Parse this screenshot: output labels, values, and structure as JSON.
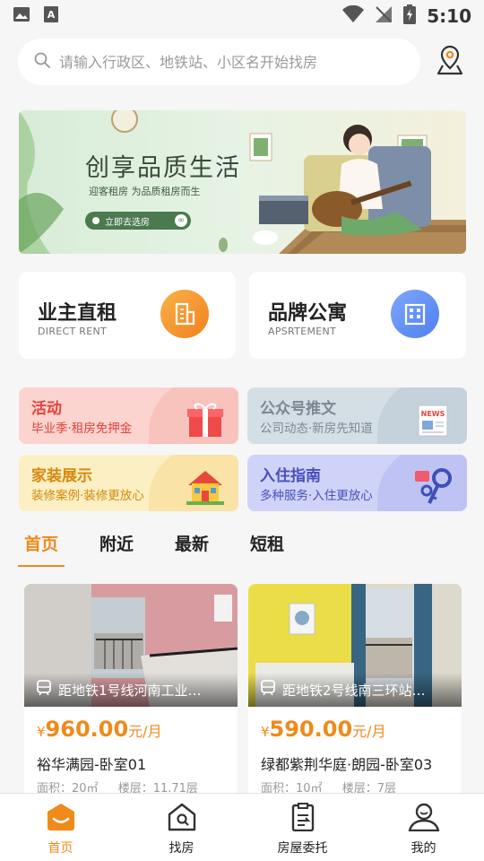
{
  "status_bar": {
    "time": "5:10"
  },
  "search": {
    "placeholder": "请输入行政区、地铁站、小区名开始找房"
  },
  "banner": {
    "title": "创享品质生活",
    "subtitle": "迎客租房 为品质租房而生",
    "cta": "立即去选房"
  },
  "categories": [
    {
      "title": "业主直租",
      "subtitle": "DIRECT RENT",
      "color": "#f59a2a"
    },
    {
      "title": "品牌公寓",
      "subtitle": "APSRTEMENT",
      "color": "#5c8ef5"
    }
  ],
  "features": [
    {
      "title": "活动",
      "subtitle": "毕业季·租房免押金",
      "bg": "#fbd4cf",
      "color": "#e5423c"
    },
    {
      "title": "公众号推文",
      "subtitle": "公司动态·新房先知道",
      "bg": "#d4dee5",
      "color": "#7d8893"
    },
    {
      "title": "家装展示",
      "subtitle": "装修案例·装修更放心",
      "bg": "#fcefc4",
      "color": "#d48a0d"
    },
    {
      "title": "入住指南",
      "subtitle": "多种服务·入住更放心",
      "bg": "#d0d3f8",
      "color": "#4a4fb8"
    }
  ],
  "tabs": [
    "首页",
    "附近",
    "最新",
    "短租"
  ],
  "listings": [
    {
      "subway": "距地铁1号线河南工业…",
      "currency": "¥",
      "price": "960.00",
      "unit": "元/月",
      "name": "裕华满园-卧室01",
      "area": "面积：20㎡",
      "floor": "楼层：11.71层"
    },
    {
      "subway": "距地铁2号线南三环站…",
      "currency": "¥",
      "price": "590.00",
      "unit": "元/月",
      "name": "绿都紫荆华庭·朗园-卧室03",
      "area": "面积：10㎡",
      "floor": "楼层：7层"
    }
  ],
  "bottom_nav": [
    "首页",
    "找房",
    "房屋委托",
    "我的"
  ],
  "colors": {
    "accent": "#ef8a1b"
  }
}
